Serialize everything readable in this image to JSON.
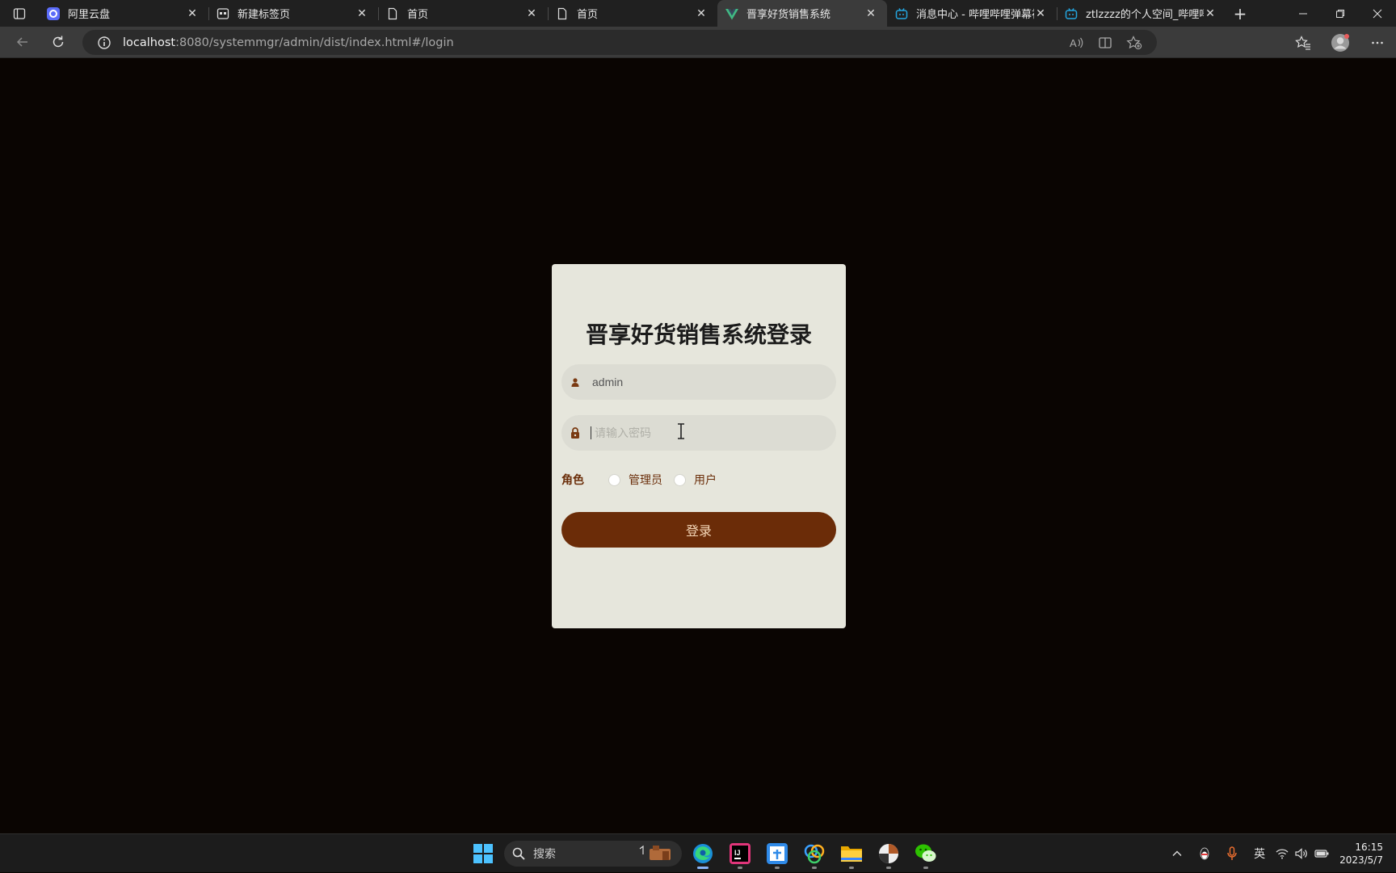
{
  "browser": {
    "tabs": [
      {
        "title": "阿里云盘",
        "favicon": "aliyun-drive-icon",
        "active": false
      },
      {
        "title": "新建标签页",
        "favicon": "new-tab-page-icon",
        "active": false
      },
      {
        "title": "首页",
        "favicon": "document-icon",
        "active": false
      },
      {
        "title": "首页",
        "favicon": "document-icon",
        "active": false
      },
      {
        "title": "晋享好货销售系统",
        "favicon": "vue-icon",
        "active": true
      },
      {
        "title": "消息中心 - 哔哩哔哩弹幕视",
        "favicon": "bilibili-icon",
        "active": false
      },
      {
        "title": "ztlzzzz的个人空间_哔哩哔",
        "favicon": "bilibili-icon",
        "active": false
      }
    ],
    "address": {
      "host": "localhost",
      "rest": ":8080/systemmgr/admin/dist/index.html#/login"
    }
  },
  "login": {
    "title": "晋享好货销售系统登录",
    "username_value": "admin",
    "password_placeholder": "请输入密码",
    "role_label": "角色",
    "role_options": [
      "管理员",
      "用户"
    ],
    "submit_label": "登录"
  },
  "taskbar": {
    "search_label": "搜索",
    "ime_label": "英",
    "time": "16:15",
    "date": "2023/5/7"
  },
  "colors": {
    "page_background": "#0a0502",
    "card_background": "#e6e6dc",
    "button_background": "#6b2c08",
    "accent_text": "#6b2e0a"
  }
}
